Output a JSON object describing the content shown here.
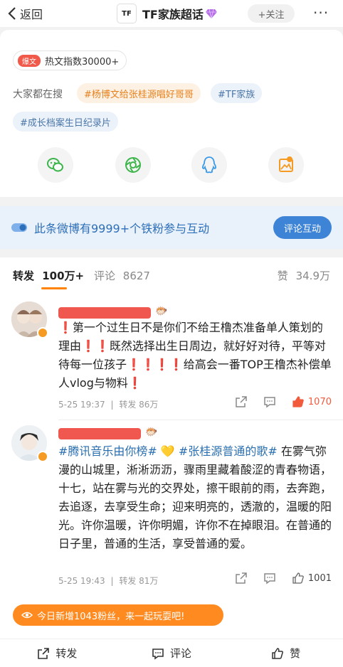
{
  "topbar": {
    "back_label": "返回",
    "logo_text": "TF",
    "title": "TF家族超话",
    "follow_label": "+关注",
    "more_label": "···"
  },
  "hot": {
    "badge": "爆文",
    "text": "热文指数30000+"
  },
  "search": {
    "label": "大家都在搜",
    "tags": [
      "#杨博文给张桂源唱好哥哥",
      "#TF家族",
      "#成长档案生日纪录片"
    ]
  },
  "share_icons": [
    "wechat-icon",
    "moments-icon",
    "qq-icon",
    "save-image-icon"
  ],
  "fans_banner": {
    "text": "此条微博有9999+个铁粉参与互动",
    "button": "评论互动"
  },
  "tabs": {
    "repost_label": "转发",
    "repost_count": "100万+",
    "comment_label": "评论",
    "comment_count": "8627",
    "likes_label": "赞",
    "likes_count": "34.9万"
  },
  "comments": [
    {
      "name_emoji": "🐡",
      "segments": [
        {
          "t": "❗",
          "c": "red"
        },
        {
          "t": "第一个过生日不是你们不给王橹杰准备单人策划的理由",
          "c": ""
        },
        {
          "t": "❗❗",
          "c": "red"
        },
        {
          "t": "既然选择出生日周边，就好好对待，平等对待每一位孩子",
          "c": ""
        },
        {
          "t": "❗❗❗❗",
          "c": "red"
        },
        {
          "t": "给高会一番TOP王橹杰补偿单人vlog与物料",
          "c": ""
        },
        {
          "t": "❗",
          "c": "red"
        }
      ],
      "time": "5-25 19:37",
      "repost": "转发 86万",
      "likes": "1070",
      "liked": true
    },
    {
      "name_emoji": "🐡",
      "segments": [
        {
          "t": "#腾讯音乐由你榜#",
          "c": "topic"
        },
        {
          "t": " 💛 ",
          "c": ""
        },
        {
          "t": "#张桂源普通的歌#",
          "c": "topic"
        },
        {
          "t": " 在雾气弥漫的山城里，淅淅沥沥，骤雨里藏着酸涩的青春物语，十七，站在雾与光的交界处，擦干眼前的雨，去奔跑，去追逐，去享受生命；迎来明亮的，透澈的，温暖的阳光。许你温暖，许你明媚，许你不在掉眼泪。在普通的日子里，普通的生活，享受普通的爱。",
          "c": ""
        }
      ],
      "time": "5-25 19:43",
      "repost": "转发 81万",
      "likes": "1001",
      "liked": false
    }
  ],
  "toast": "今日新增1043粉丝，来一起玩耍吧!",
  "bottombar": {
    "repost": "转发",
    "comment": "评论",
    "like": "赞"
  },
  "colors": {
    "accent": "#ff8200",
    "link": "#2a6fb0",
    "liked": "#f25a3c"
  }
}
